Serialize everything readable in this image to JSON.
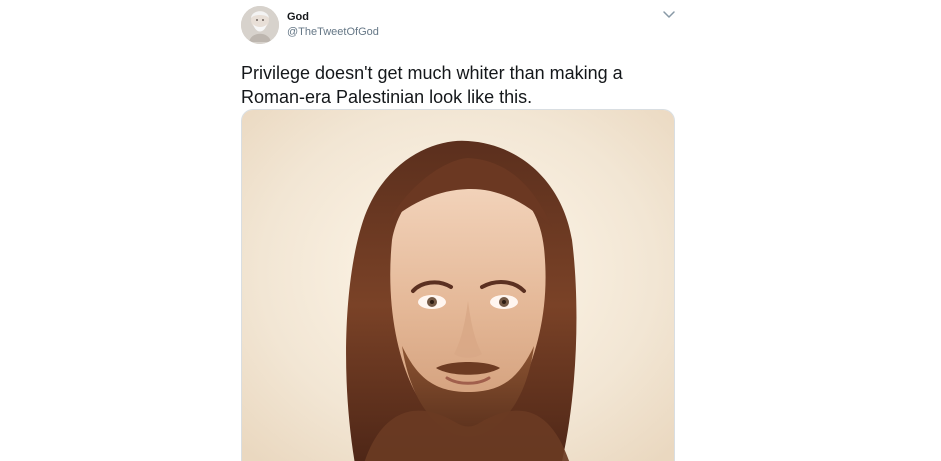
{
  "tweet": {
    "author": {
      "name": "God",
      "handle": "@TheTweetOfGod"
    },
    "text_lines": [
      "Privilege doesn't get much whiter than making a",
      "Roman-era Palestinian look like this."
    ],
    "icons": {
      "avatar": "avatar-photo",
      "menu": "chevron-down-icon",
      "media": "portrait-image"
    },
    "colors": {
      "name": "#14171a",
      "handle": "#657786",
      "border": "#d9dee2",
      "background": "#ffffff"
    }
  }
}
